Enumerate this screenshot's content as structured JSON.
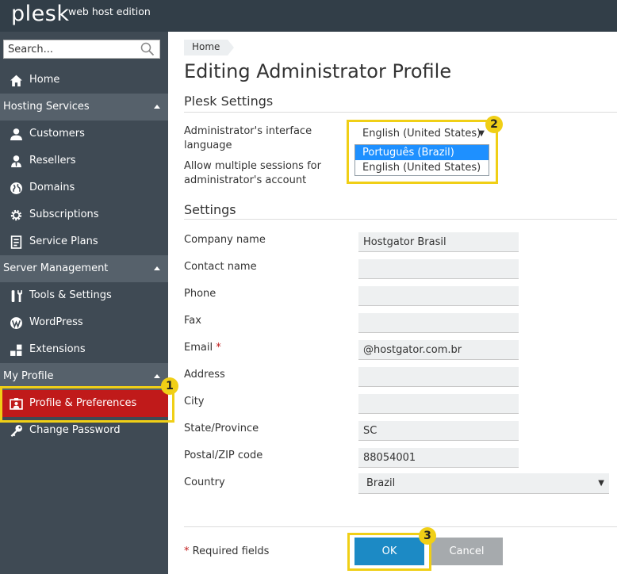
{
  "app": {
    "logo": "plesk",
    "edition": "web host edition"
  },
  "sidebar": {
    "search_placeholder": "Search...",
    "home": "Home",
    "sections": [
      {
        "label": "Hosting Services",
        "items": [
          "Customers",
          "Resellers",
          "Domains",
          "Subscriptions",
          "Service Plans"
        ]
      },
      {
        "label": "Server Management",
        "items": [
          "Tools & Settings",
          "WordPress",
          "Extensions"
        ]
      },
      {
        "label": "My Profile",
        "items": [
          "Profile & Preferences",
          "Change Password"
        ]
      }
    ],
    "active_item": "Profile & Preferences"
  },
  "breadcrumb": "Home",
  "page_title": "Editing Administrator Profile",
  "plesk_settings": {
    "title": "Plesk Settings",
    "language_label": "Administrator's interface language",
    "language_label_line1": "Administrator's interface",
    "language_label_line2": "language",
    "language_value": "English (United States)",
    "language_options": [
      "Português (Brazil)",
      "English (United States)"
    ],
    "sessions_label_line1": "Allow multiple sessions for",
    "sessions_label_line2": "administrator's account"
  },
  "settings": {
    "title": "Settings",
    "fields": [
      {
        "label": "Company name",
        "value": "Hostgator Brasil"
      },
      {
        "label": "Contact name",
        "value": ""
      },
      {
        "label": "Phone",
        "value": ""
      },
      {
        "label": "Fax",
        "value": ""
      },
      {
        "label": "Email",
        "value": "@hostgator.com.br",
        "required": true
      },
      {
        "label": "Address",
        "value": ""
      },
      {
        "label": "City",
        "value": ""
      },
      {
        "label": "State/Province",
        "value": "SC"
      },
      {
        "label": "Postal/ZIP code",
        "value": "88054001"
      },
      {
        "label": "Country",
        "value": "Brazil"
      }
    ]
  },
  "footer": {
    "required_star": "*",
    "required_text": "Required fields",
    "ok_label": "OK",
    "cancel_label": "Cancel"
  },
  "annotations": {
    "badge1": "1",
    "badge2": "2",
    "badge3": "3",
    "highlight_color": "#f0cf16"
  },
  "colors": {
    "topbar": "#323e48",
    "sidebar": "#3f4a54",
    "section": "#56616b",
    "active": "#c01a1a",
    "ok_button": "#1c8ac5",
    "cancel_button": "#a6aaad",
    "option_selected": "#1e90ff"
  }
}
